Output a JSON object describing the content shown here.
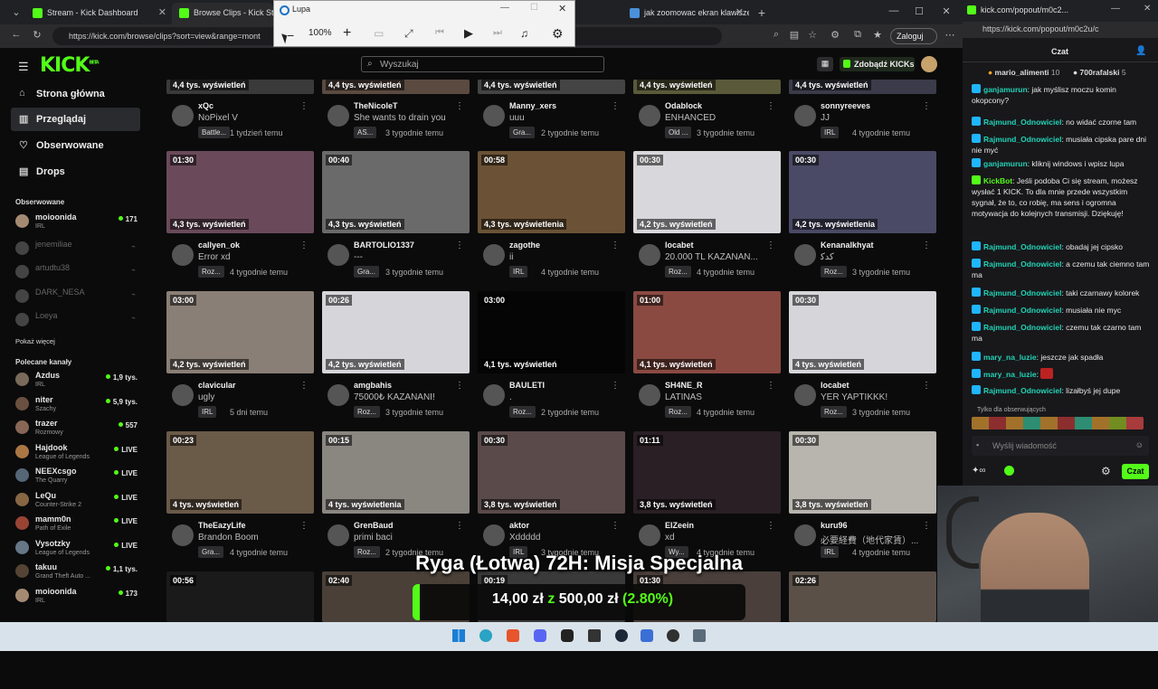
{
  "browser": {
    "tabs": [
      {
        "label": "Stream - Kick Dashboard"
      },
      {
        "label": "Browse Clips - Kick Stream"
      },
      {
        "label": "jak zoomowac ekran klawiszem kl"
      }
    ],
    "url": "https://kick.com/browse/clips?sort=view&range=mont",
    "login_label": "Zaloguj"
  },
  "lupa": {
    "title": "Lupa",
    "zoom": "100%"
  },
  "kick": {
    "logo": "KICK",
    "logo_beta": "BETA",
    "search_placeholder": "Wyszukaj",
    "get_kicks_label": "Zdobądź KICKs",
    "nav": [
      {
        "label": "Strona główna",
        "icon": "home-icon"
      },
      {
        "label": "Przeglądaj",
        "icon": "browse-icon"
      },
      {
        "label": "Obserwowane",
        "icon": "heart-icon"
      },
      {
        "label": "Drops",
        "icon": "drops-icon"
      }
    ],
    "followed_header": "Obserwowane",
    "followed": [
      {
        "name": "moioonida",
        "sub": "IRL",
        "viewers": "171",
        "live": true
      },
      {
        "name": "jenemiliae",
        "sub": "",
        "viewers": "",
        "live": false
      },
      {
        "name": "artudtu38",
        "sub": "",
        "viewers": "",
        "live": false
      },
      {
        "name": "DARK_NESA",
        "sub": "",
        "viewers": "",
        "live": false
      },
      {
        "name": "Loeya",
        "sub": "",
        "viewers": "",
        "live": false
      }
    ],
    "show_more": "Pokaż więcej",
    "recommended_header": "Polecane kanały",
    "recommended": [
      {
        "name": "Azdus",
        "sub": "IRL",
        "viewers": "1,9 tys."
      },
      {
        "name": "niter",
        "sub": "Szachy",
        "viewers": "5,9 tys."
      },
      {
        "name": "trazer",
        "sub": "Rozmowy",
        "viewers": "557"
      },
      {
        "name": "Hajdook",
        "sub": "League of Legends",
        "viewers": "LIVE"
      },
      {
        "name": "NEEXcsgo",
        "sub": "The Quarry",
        "viewers": "LIVE"
      },
      {
        "name": "LeQu",
        "sub": "Counter-Strike 2",
        "viewers": "LIVE"
      },
      {
        "name": "mamm0n",
        "sub": "Path of Exile",
        "viewers": "LIVE"
      },
      {
        "name": "Vysotzky",
        "sub": "League of Legends",
        "viewers": "LIVE"
      },
      {
        "name": "takuu",
        "sub": "Grand Theft Auto ...",
        "viewers": "1,1 tys."
      },
      {
        "name": "moioonida",
        "sub": "IRL",
        "viewers": "173"
      }
    ],
    "clip_rows": [
      [
        {
          "dur": "",
          "views": "4,4 tys. wyświetleń",
          "channel": "xQc",
          "title": "NoPixel V",
          "cat": "Battle...",
          "ago": "1 tydzień temu",
          "bg": "#3a3a3a"
        },
        {
          "dur": "",
          "views": "4,4 tys. wyświetleń",
          "channel": "TheNicoleT",
          "title": "She wants to drain you",
          "cat": "AS...",
          "ago": "3 tygodnie temu",
          "bg": "#5a4a40"
        },
        {
          "dur": "",
          "views": "4,4 tys. wyświetleń",
          "channel": "Manny_xers",
          "title": "uuu",
          "cat": "Gra...",
          "ago": "2 tygodnie temu",
          "bg": "#444"
        },
        {
          "dur": "",
          "views": "4,4 tys. wyświetleń",
          "channel": "Odablock",
          "title": "ENHANCED",
          "cat": "Old ...",
          "ago": "3 tygodnie temu",
          "bg": "#5a5a3a"
        },
        {
          "dur": "",
          "views": "4,4 tys. wyświetleń",
          "channel": "sonnyreeves",
          "title": "JJ",
          "cat": "IRL",
          "ago": "4 tygodnie temu",
          "bg": "#3b3b4a"
        }
      ],
      [
        {
          "dur": "01:30",
          "views": "4,3 tys. wyświetleń",
          "channel": "callyen_ok",
          "title": "Error xd",
          "cat": "Roz...",
          "ago": "4 tygodnie temu",
          "bg": "#6a4a5a"
        },
        {
          "dur": "00:40",
          "views": "4,3 tys. wyświetleń",
          "channel": "BARTOLIO1337",
          "title": "---",
          "cat": "Gra...",
          "ago": "3 tygodnie temu",
          "bg": "#6a6a6a"
        },
        {
          "dur": "00:58",
          "views": "4,3 tys. wyświetlenia",
          "channel": "zagothe",
          "title": "ii",
          "cat": "IRL",
          "ago": "4 tygodnie temu",
          "bg": "#6b5236"
        },
        {
          "dur": "00:30",
          "views": "4,2 tys. wyświetleń",
          "channel": "locabet",
          "title": "20.000 TL KAZANAN...",
          "cat": "Roz...",
          "ago": "4 tygodnie temu",
          "bg": "#d8d8dc"
        },
        {
          "dur": "00:30",
          "views": "4,2 tys. wyświetlenia",
          "channel": "Kenanalkhyat",
          "title": "ﻛﺪﻛ",
          "cat": "Roz...",
          "ago": "3 tygodnie temu",
          "bg": "#4a4a66"
        }
      ],
      [
        {
          "dur": "03:00",
          "views": "4,2 tys. wyświetleń",
          "channel": "clavicular",
          "title": "ugly",
          "cat": "IRL",
          "ago": "5 dni temu",
          "bg": "#8a7f76"
        },
        {
          "dur": "00:26",
          "views": "4,2 tys. wyświetleń",
          "channel": "amgbahis",
          "title": "75000₺ KAZANANI!",
          "cat": "Roz...",
          "ago": "3 tygodnie temu",
          "bg": "#d6d6da"
        },
        {
          "dur": "03:00",
          "views": "4,1 tys. wyświetleń",
          "channel": "BAULETI",
          "title": ".",
          "cat": "Roz...",
          "ago": "2 tygodnie temu",
          "bg": "#050505"
        },
        {
          "dur": "01:00",
          "views": "4,1 tys. wyświetleń",
          "channel": "SH4NE_R",
          "title": "LATINAS",
          "cat": "Roz...",
          "ago": "4 tygodnie temu",
          "bg": "#8a4a42"
        },
        {
          "dur": "00:30",
          "views": "4 tys. wyświetleń",
          "channel": "locabet",
          "title": "YER YAPTIKKK!",
          "cat": "Roz...",
          "ago": "3 tygodnie temu",
          "bg": "#d6d6da"
        }
      ],
      [
        {
          "dur": "00:23",
          "views": "4 tys. wyświetleń",
          "channel": "TheEazyLife",
          "title": "Brandon Boom",
          "cat": "Gra...",
          "ago": "4 tygodnie temu",
          "bg": "#6a5a48"
        },
        {
          "dur": "00:15",
          "views": "4 tys. wyświetlenia",
          "channel": "GrenBaud",
          "title": "primi baci",
          "cat": "Roz...",
          "ago": "2 tygodnie temu",
          "bg": "#8a8680"
        },
        {
          "dur": "00:30",
          "views": "3,8 tys. wyświetleń",
          "channel": "aktor",
          "title": "Xddddd",
          "cat": "IRL",
          "ago": "3 tygodnie temu",
          "bg": "#5a4a4a"
        },
        {
          "dur": "01:11",
          "views": "3,8 tys. wyświetleń",
          "channel": "ElZeein",
          "title": "xd",
          "cat": "Wy...",
          "ago": "4 tygodnie temu",
          "bg": "#2a1f24"
        },
        {
          "dur": "00:30",
          "views": "3,8 tys. wyświetleń",
          "channel": "kuru96",
          "title": "必要経費（地代家賃）...",
          "cat": "IRL",
          "ago": "4 tygodnie temu",
          "bg": "#b8b4ae"
        }
      ],
      [
        {
          "dur": "00:56",
          "views": "",
          "channel": "",
          "title": "",
          "cat": "",
          "ago": "",
          "bg": "#1a1a1a"
        },
        {
          "dur": "02:40",
          "views": "",
          "channel": "",
          "title": "",
          "cat": "",
          "ago": "",
          "bg": "#4a4038"
        },
        {
          "dur": "00:19",
          "views": "",
          "channel": "",
          "title": "",
          "cat": "",
          "ago": "",
          "bg": "#3a3a3a"
        },
        {
          "dur": "01:30",
          "views": "",
          "channel": "",
          "title": "",
          "cat": "",
          "ago": "",
          "bg": "#4a3f3a"
        },
        {
          "dur": "02:26",
          "views": "",
          "channel": "",
          "title": "",
          "cat": "",
          "ago": "",
          "bg": "#5a5048"
        }
      ]
    ]
  },
  "chat_window": {
    "url": "https://kick.com/popout/m0c2u/c",
    "title_bar": "kick.com/popout/m0c2...",
    "header": "Czat",
    "top_gifters": [
      {
        "name": "mario_alimenti",
        "count": "10"
      },
      {
        "name": "700rafalski",
        "count": "5"
      }
    ],
    "messages": [
      {
        "user": "ganjamurun",
        "text": "jak myślisz moczu komin okopcony?",
        "color": "#22d3b6"
      },
      {
        "user": "Rajmund_Odnowiciel",
        "text": "no widać czorne tam",
        "color": "#22d3b6"
      },
      {
        "user": "Rajmund_Odnowiciel",
        "text": "musiała cipska pare dni nie myć",
        "color": "#22d3b6"
      },
      {
        "user": "ganjamurun",
        "text": "kliknij windows i wpisz lupa",
        "color": "#22d3b6"
      },
      {
        "user": "KickBot",
        "text": "Jeśli podoba Ci się stream, możesz wysłać 1 KICK. To dla mnie przede wszystkim sygnał, że to, co robię, ma sens i ogromna motywacja do kolejnych transmisji. Dziękuję!",
        "color": "#53fc18"
      },
      {
        "user": "Rajmund_Odnowiciel",
        "text": "obadaj jej cipsko",
        "color": "#22d3b6"
      },
      {
        "user": "Rajmund_Odnowiciel",
        "text": "a czemu tak ciemno tam ma",
        "color": "#22d3b6"
      },
      {
        "user": "Rajmund_Odnowiciel",
        "text": "taki czarnawy kolorek",
        "color": "#22d3b6"
      },
      {
        "user": "Rajmund_Odnowiciel",
        "text": "musiała nie myc",
        "color": "#22d3b6"
      },
      {
        "user": "Rajmund_Odnowiciel",
        "text": "czemu tak czarno tam ma",
        "color": "#22d3b6"
      },
      {
        "user": "mary_na_luzie",
        "text": "jeszcze jak spadła",
        "color": "#22d3b6"
      },
      {
        "user": "mary_na_luzie",
        "text": "",
        "color": "#22d3b6"
      },
      {
        "user": "Rajmund_Odnowiciel",
        "text": "lizałbyś jej dupe",
        "color": "#22d3b6"
      }
    ],
    "followers_only": "Tylko dla obserwujących",
    "input_placeholder": "Wyślij wiadomość",
    "send_label": "Czat"
  },
  "overlay": {
    "banner_title": "Ryga (Łotwa) 72H: Misja Specjalna",
    "amount_current": "14,00 zł",
    "amount_sep": "z",
    "amount_goal": "500,00 zł",
    "amount_pct": "(2.80%)"
  },
  "colors": {
    "accent": "#53fc18",
    "user": "#22d3b6",
    "bg": "#0b0b0c"
  }
}
